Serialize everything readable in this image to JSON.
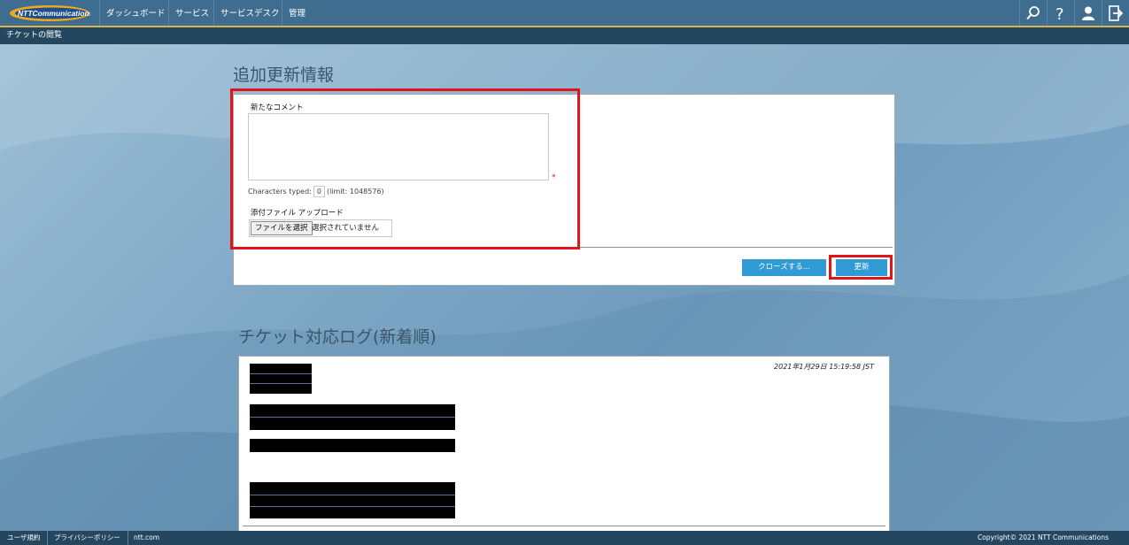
{
  "brand": {
    "name": "NTTCommunications"
  },
  "nav": {
    "items": [
      "ダッシュボード",
      "サービス",
      "サービスデスク",
      "管理"
    ],
    "icons": [
      "search-icon",
      "help-icon",
      "user-icon",
      "logout-icon"
    ]
  },
  "breadcrumb": "チケットの閲覧",
  "update_section": {
    "title": "追加更新情報",
    "comment_label": "新たなコメント",
    "comment_value": "",
    "required_mark": "*",
    "chars_typed_label": "Characters typed:",
    "chars_typed_value": "0",
    "chars_limit": "(limit: 1048576)",
    "attachment_label": "添付ファイル アップロード",
    "file_button": "ファイルを選択",
    "file_status": "選択されていません",
    "close_button": "クローズする...",
    "update_button": "更新"
  },
  "log_section": {
    "title": "チケット対応ログ(新着順)",
    "timestamp": "2021年1月29日 15:19:58 JST"
  },
  "footer": {
    "links": [
      "ユーザ規約",
      "プライバシーポリシー",
      "ntt.com"
    ],
    "copyright": "Copyright© 2021 NTT Communications"
  },
  "colors": {
    "topbar": "#3f6d8f",
    "subbar": "#24475f",
    "accent_line": "#d9b24a",
    "button_blue": "#2f9ad3",
    "highlight_red": "#e0141b"
  }
}
